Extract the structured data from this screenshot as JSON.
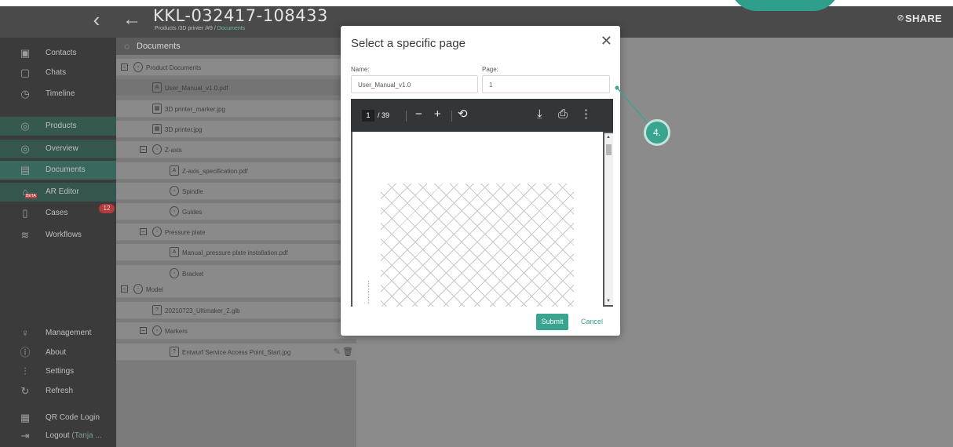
{
  "header": {
    "title": "KKL-032417-108433",
    "breadcrumb_prefix": "Products /3D printer /#9 /",
    "breadcrumb_active": "Documents",
    "share_label": "SHARE"
  },
  "sidebar": {
    "items": [
      {
        "label": "Contacts",
        "icon": "contacts-icon"
      },
      {
        "label": "Chats",
        "icon": "chat-icon"
      },
      {
        "label": "Timeline",
        "icon": "clock-icon"
      },
      {
        "label": "Products",
        "icon": "products-icon"
      },
      {
        "label": "Overview",
        "icon": "overview-icon"
      },
      {
        "label": "Documents",
        "icon": "documents-icon"
      },
      {
        "label": "AR Editor",
        "icon": "ar-editor-icon",
        "beta": "BETA"
      },
      {
        "label": "Cases",
        "icon": "cases-icon",
        "badge": "12"
      },
      {
        "label": "Workflows",
        "icon": "workflows-icon"
      },
      {
        "label": "Management",
        "icon": "management-icon"
      },
      {
        "label": "About",
        "icon": "about-icon"
      },
      {
        "label": "Settings",
        "icon": "settings-icon"
      },
      {
        "label": "Refresh",
        "icon": "refresh-icon"
      },
      {
        "label": "QR Code Login",
        "icon": "qr-code-icon"
      },
      {
        "label": "Logout",
        "icon": "logout-icon",
        "user": "(Tanja ..."
      }
    ]
  },
  "tree": {
    "header": "Documents",
    "rows": [
      {
        "label": "Product Documents"
      },
      {
        "label": "User_Manual_v1.0.pdf"
      },
      {
        "label": "3D printer_marker.jpg"
      },
      {
        "label": "3D printer.jpg"
      },
      {
        "label": "Z-axis"
      },
      {
        "label": "Z-axis_specification.pdf"
      },
      {
        "label": "Spindle"
      },
      {
        "label": "Guides"
      },
      {
        "label": "Pressure plate"
      },
      {
        "label": "Manual_pressure plate installation.pdf"
      },
      {
        "label": "Bracket"
      },
      {
        "label": "Model"
      },
      {
        "label": "20210723_Ultimaker_2.glb"
      },
      {
        "label": "Markers"
      },
      {
        "label": "Entwurf Service Access Point_Start.jpg"
      }
    ]
  },
  "modal": {
    "title": "Select a specific page",
    "name_label": "Name:",
    "name_value": "User_Manual_v1.0",
    "page_label": "Page:",
    "page_value": "1",
    "pdf": {
      "current_page": "1",
      "total_pages": "/ 39"
    },
    "submit_label": "Submit",
    "cancel_label": "Cancel"
  },
  "callout": {
    "step": "4."
  },
  "colors": {
    "accent": "#3aa58f",
    "sidebar_bg": "#3b3b3b",
    "badge": "#b23c3c"
  }
}
